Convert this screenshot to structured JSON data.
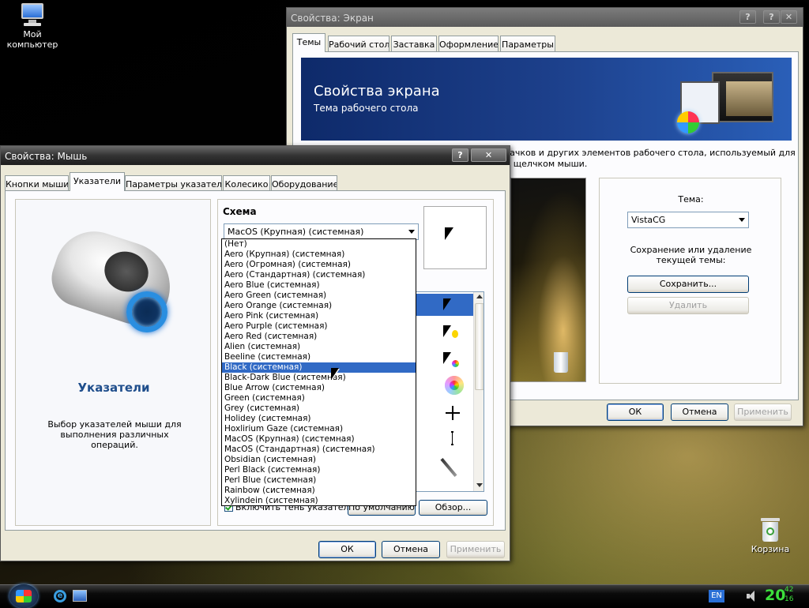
{
  "desktop": {
    "my_computer": "Мой\nкомпьютер",
    "recycle_bin": "Корзина"
  },
  "display": {
    "title": "Свойства: Экран",
    "tabs": [
      "Темы",
      "Рабочий стол",
      "Заставка",
      "Оформление",
      "Параметры"
    ],
    "banner_title": "Свойства экрана",
    "banner_subtitle": "Тема рабочего стола",
    "desc_line1": "начков и других элементов рабочего стола, используемый для",
    "desc_line2": "м щелчком мыши.",
    "theme_label": "Тема:",
    "theme_value": "VistaCG",
    "save_delete_text": "Сохранение или удаление текущей темы:",
    "save_button": "Сохранить...",
    "delete_button": "Удалить",
    "ok": "ОК",
    "cancel": "Отмена",
    "apply": "Применить"
  },
  "mouse": {
    "title": "Свойства: Мышь",
    "help_button": "?",
    "close_button": "✕",
    "tabs": [
      "Кнопки мыши",
      "Указатели",
      "Параметры указателя",
      "Колесико",
      "Оборудование"
    ],
    "heading": "Указатели",
    "description": "Выбор указателей мыши для выполнения различных операций.",
    "scheme_label": "Схема",
    "scheme_value": "MacOS (Крупная) (системная)",
    "scheme_options": [
      "(Нет)",
      "Aero (Крупная) (системная)",
      "Aero (Огромная) (системная)",
      "Aero (Стандартная) (системная)",
      "Aero Blue (системная)",
      "Aero Green (системная)",
      "Aero Orange (системная)",
      "Aero Pink (системная)",
      "Aero Purple (системная)",
      "Aero Red (системная)",
      "Alien (системная)",
      "Beeline (системная)",
      "Black (системная)",
      "Black-Dark Blue (системная)",
      "Blue Arrow (системная)",
      "Green (системная)",
      "Grey (системная)",
      "Holidey (системная)",
      "Hoxlirium Gaze (системная)",
      "MacOS (Крупная) (системная)",
      "MacOS (Стандартная) (системная)",
      "Obsidian (системная)",
      "Perl Black (системная)",
      "Perl Blue (системная)",
      "Rainbow (системная)",
      "Xylindein (системная)"
    ],
    "highlighted_option": "Black (системная)",
    "shadow_checkbox": "Включить тень указателя",
    "shadow_checked": true,
    "default_button": "По умолчанию",
    "browse_button": "Обзор...",
    "ok": "ОК",
    "cancel": "Отмена",
    "apply": "Применить"
  },
  "taskbar": {
    "language": "EN",
    "clock_hour": "20",
    "clock_min": "42",
    "clock_sec": "16"
  },
  "colors": {
    "selection": "#316ac5",
    "banner": "#1c3f8a",
    "accent_heading": "#1f4e8c",
    "clock": "#3ce03c"
  }
}
